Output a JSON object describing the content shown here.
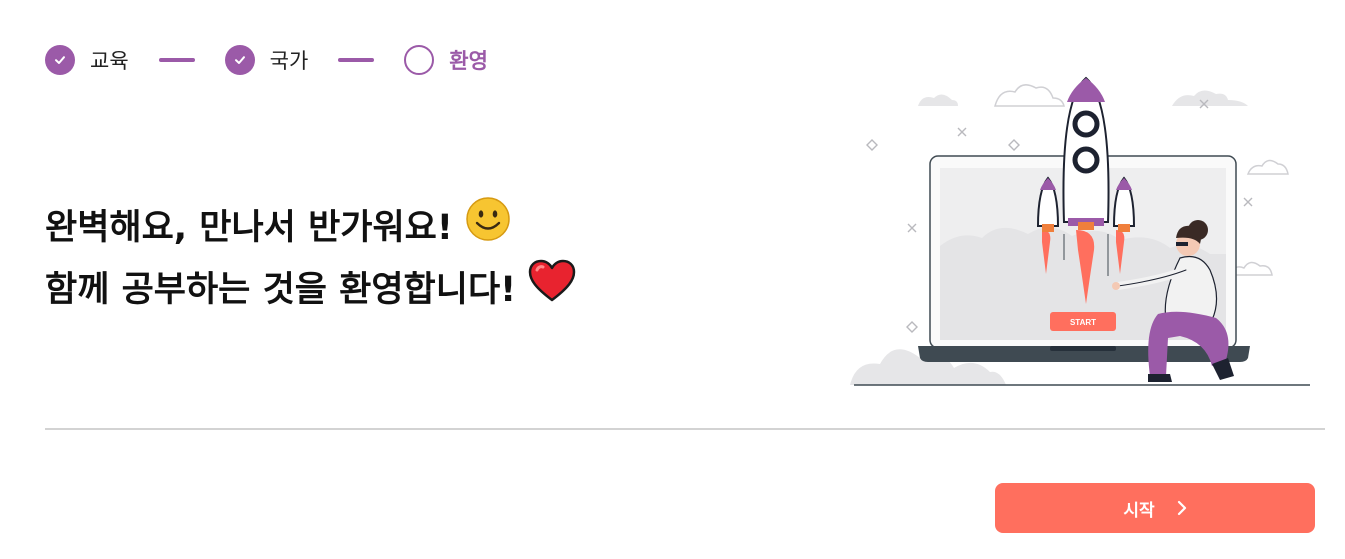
{
  "stepper": {
    "steps": [
      {
        "label": "교육",
        "state": "completed",
        "icon": "check-icon"
      },
      {
        "label": "국가",
        "state": "completed",
        "icon": "check-icon"
      },
      {
        "label": "환영",
        "state": "current",
        "icon": "empty-circle-icon"
      }
    ]
  },
  "welcome": {
    "line1": "완벽해요, 만나서 반가워요!",
    "line1_emoji": "smiling-face-emoji",
    "line2": "함께 공부하는 것을 환영합니다!",
    "line2_emoji": "red-heart-emoji"
  },
  "illustration": {
    "name": "rocket-launch-laptop-illustration",
    "laptop_button_label": "START"
  },
  "footer": {
    "start_button_label": "시작",
    "start_button_icon": "chevron-right-icon"
  },
  "colors": {
    "accent_purple": "#9b5aa8",
    "button_coral": "#ff6f5e",
    "divider": "#d3d3d3"
  }
}
